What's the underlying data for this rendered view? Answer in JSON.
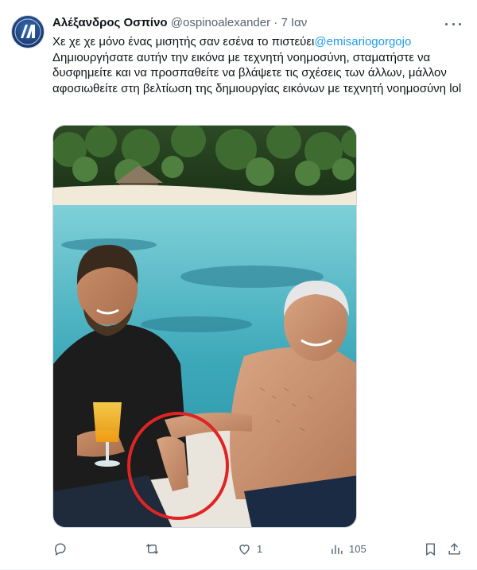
{
  "tweet": {
    "display_name": "Αλέξανδρος Οσπίνο",
    "handle": "@ospinoalexander",
    "separator": "·",
    "time": "7 Ιαν",
    "text_prefix": "Χε χε χε μόνο ένας μισητής σαν εσένα το πιστεύει",
    "mention": "@emisariogorgojo",
    "text_body": "Δημιουργήσατε αυτήν την εικόνα με τεχνητή νοημοσύνη, σταματήστε να δυσφημείτε και να προσπαθείτε να βλάψετε τις σχέσεις των άλλων, μάλλον αφοσιωθείτε στη βελτίωση της δημιουργίας εικόνων με τεχνητή νοημοσύνη lol"
  },
  "actions": {
    "reply_count": "",
    "retweet_count": "",
    "like_count": "1",
    "views_count": "105"
  },
  "icons": {
    "avatar": "avatar-icon",
    "more": "more-options-icon",
    "reply": "reply-icon",
    "retweet": "retweet-icon",
    "like": "heart-icon",
    "views": "views-icon",
    "bookmark": "bookmark-icon",
    "share": "share-icon"
  },
  "colors": {
    "text": "#0f1419",
    "secondary": "#536471",
    "link": "#1d9bf0",
    "highlight_circle": "#e02424"
  }
}
